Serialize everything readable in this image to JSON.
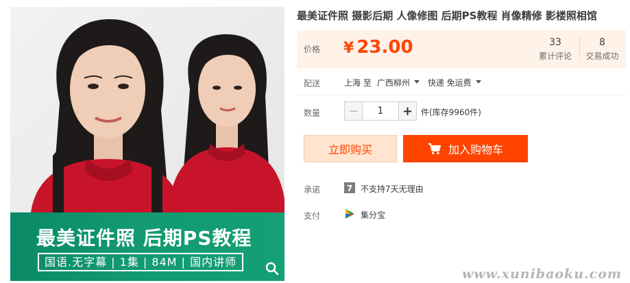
{
  "product": {
    "title": "最美证件照 摄影后期 人像修图 后期PS教程 肖像精修 影楼照相馆",
    "image_banner": {
      "title": "最美证件照 后期PS教程",
      "subtitle": "国语.无字幕 | 1集 | 84M | 国内讲师"
    }
  },
  "price": {
    "label": "价格",
    "currency": "¥",
    "amount": "23.00",
    "reviews_count": "33",
    "reviews_label": "累计评论",
    "deals_count": "8",
    "deals_label": "交易成功"
  },
  "shipping": {
    "label": "配送",
    "from": "上海 至",
    "to": "广西柳州",
    "method": "快递 免运费"
  },
  "quantity": {
    "label": "数量",
    "value": "1",
    "minus": "−",
    "plus": "+",
    "stock_text": "件(库存9960件)"
  },
  "actions": {
    "buy_now": "立即购买",
    "add_to_cart": "加入购物车"
  },
  "promise": {
    "label": "承诺",
    "icon_text": "7",
    "text": "不支持7天无理由"
  },
  "payment": {
    "label": "支付",
    "method": "集分宝"
  },
  "watermark": "www.xunibaoku.com",
  "colors": {
    "accent": "#ff4400",
    "price_bg": "#fff2e8",
    "buy_bg": "#ffe4d0",
    "banner_green": "#129a6f"
  },
  "icons": {
    "zoom": "search-icon",
    "cart": "shopping-cart-icon",
    "promise": "seven-days-icon",
    "payment": "jifenbao-icon"
  }
}
